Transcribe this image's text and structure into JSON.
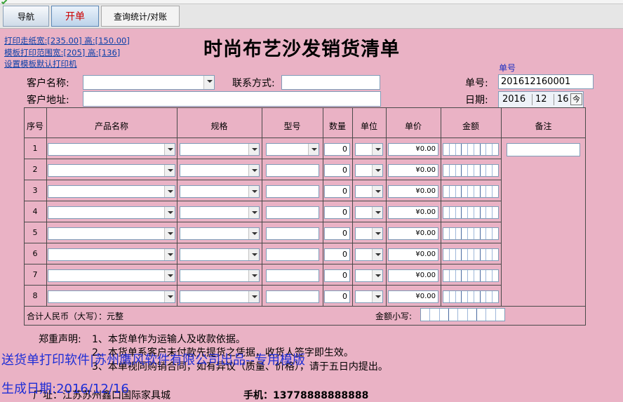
{
  "tabs": [
    {
      "label": "导航"
    },
    {
      "label": "开单"
    },
    {
      "label": "查询统计/对账"
    }
  ],
  "print_links": {
    "paper_size": "打印走纸宽:[235.00] 高:[150.00]",
    "template_range": "模板打印范围宽:[205] 高:[136]",
    "set_printer": "设置模板默认打印机"
  },
  "title": "时尚布艺沙发销货清单",
  "form": {
    "customer_name_label": "客户名称:",
    "contact_label": "联系方式:",
    "address_label": "客户地址:",
    "order_no_small_label": "单号",
    "order_no_label": "单号:",
    "order_no_value": "201612160001",
    "date_label": "日期:",
    "date_year": "2016",
    "date_month": "12",
    "date_day": "16",
    "calendar_button": "今"
  },
  "table": {
    "headers": [
      "序号",
      "产品名称",
      "规格",
      "型号",
      "数量",
      "单位",
      "单价",
      "金额",
      "备注"
    ],
    "rows": [
      {
        "no": "1",
        "qty": "0",
        "price": "¥0.00"
      },
      {
        "no": "2",
        "qty": "0",
        "price": "¥0.00"
      },
      {
        "no": "3",
        "qty": "0",
        "price": "¥0.00"
      },
      {
        "no": "4",
        "qty": "0",
        "price": "¥0.00"
      },
      {
        "no": "5",
        "qty": "0",
        "price": "¥0.00"
      },
      {
        "no": "6",
        "qty": "0",
        "price": "¥0.00"
      },
      {
        "no": "7",
        "qty": "0",
        "price": "¥0.00"
      },
      {
        "no": "8",
        "qty": "0",
        "price": "¥0.00"
      }
    ],
    "total_rmb_label": "合计人民币（大写）：元整",
    "amount_subtotal_label": "金额小写:"
  },
  "notice": {
    "label": "郑重声明:",
    "line1": "1、本货单作为运输人及收款依据。",
    "line2": "2、本货单系客户未付款先提货之凭据，收货人签字即生效。",
    "line3": "3、本单视同购销合同，如有异议（质量、价格），请于五日内提出。"
  },
  "watermark": {
    "line1": "送货单打印软件|苏州鹰风软件有限公司出品--专用模版",
    "line2": "生成日期:2016/12/16"
  },
  "footer": {
    "factory": "厂址：江苏苏州鑫口国际家具城",
    "mobile": "手机：13778888888888"
  }
}
